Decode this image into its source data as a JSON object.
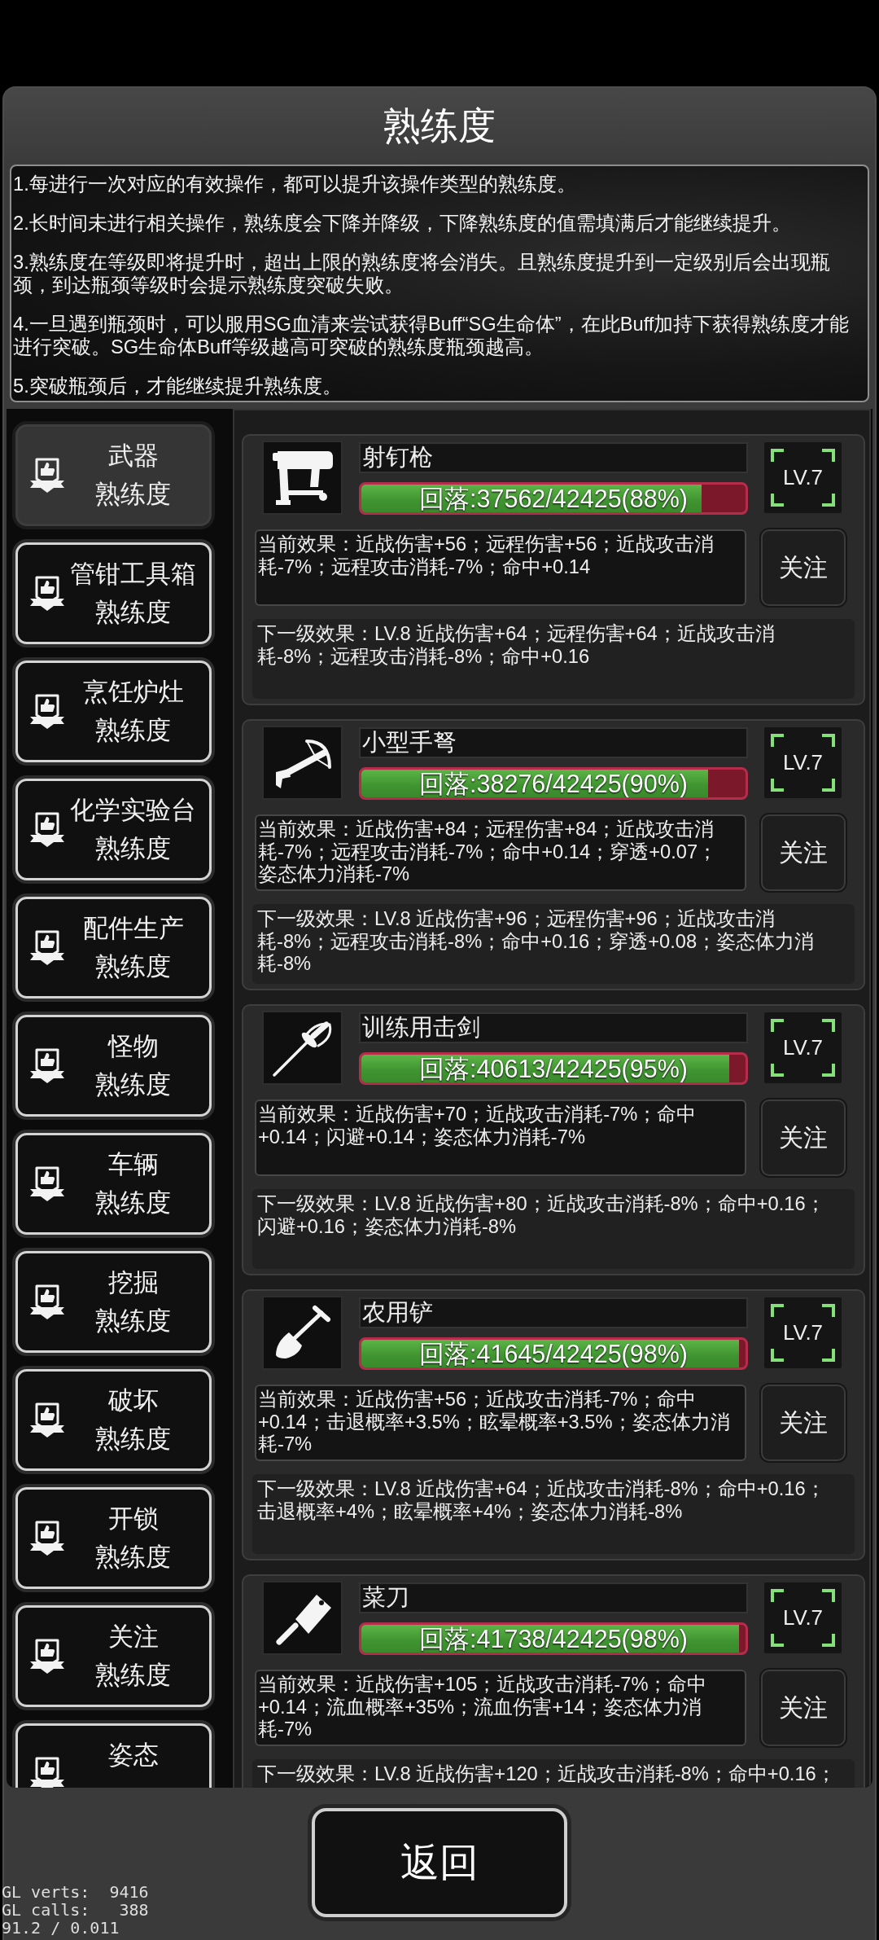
{
  "screen": {
    "title": "熟练度"
  },
  "rules": [
    "1.每进行一次对应的有效操作，都可以提升该操作类型的熟练度。",
    "2.长时间未进行相关操作，熟练度会下降并降级，下降熟练度的值需填满后才能继续提升。",
    "3.熟练度在等级即将提升时，超出上限的熟练度将会消失。且熟练度提升到一定级别后会出现瓶颈，到达瓶颈等级时会提示熟练度突破失败。",
    "4.一旦遇到瓶颈时，可以服用SG血清来尝试获得Buff“SG生命体”，在此Buff加持下获得熟练度才能进行突破。SG生命体Buff等级越高可突破的熟练度瓶颈越高。",
    "5.突破瓶颈后，才能继续提升熟练度。"
  ],
  "sidebar": {
    "items": [
      {
        "title": "武器",
        "subtitle": "熟练度",
        "selected": true
      },
      {
        "title": "管钳工具箱",
        "subtitle": "熟练度",
        "selected": false
      },
      {
        "title": "烹饪炉灶",
        "subtitle": "熟练度",
        "selected": false
      },
      {
        "title": "化学实验台",
        "subtitle": "熟练度",
        "selected": false
      },
      {
        "title": "配件生产",
        "subtitle": "熟练度",
        "selected": false
      },
      {
        "title": "怪物",
        "subtitle": "熟练度",
        "selected": false
      },
      {
        "title": "车辆",
        "subtitle": "熟练度",
        "selected": false
      },
      {
        "title": "挖掘",
        "subtitle": "熟练度",
        "selected": false
      },
      {
        "title": "破坏",
        "subtitle": "熟练度",
        "selected": false
      },
      {
        "title": "开锁",
        "subtitle": "熟练度",
        "selected": false
      },
      {
        "title": "关注",
        "subtitle": "熟练度",
        "selected": false
      },
      {
        "title": "姿态",
        "selected": false
      }
    ]
  },
  "cards": [
    {
      "name": "射钉枪",
      "progress": {
        "label": "回落:37562/42425(88%)",
        "level": 0.885
      },
      "level_badge": "LV.7",
      "current_effect": "当前效果：近战伤害+56；远程伤害+56；近战攻击消耗-7%；远程攻击消耗-7%；命中+0.14",
      "follow_button": "关注",
      "next_effect": "下一级效果：LV.8 近战伤害+64；远程伤害+64；近战攻击消耗-8%；远程攻击消耗-8%；命中+0.16"
    },
    {
      "name": "小型手弩",
      "progress": {
        "label": "回落:38276/42425(90%)",
        "level": 0.902
      },
      "level_badge": "LV.7",
      "current_effect": "当前效果：近战伤害+84；远程伤害+84；近战攻击消耗-7%；远程攻击消耗-7%；命中+0.14；穿透+0.07；姿态体力消耗-7%",
      "follow_button": "关注",
      "next_effect": "下一级效果：LV.8 近战伤害+96；远程伤害+96；近战攻击消耗-8%；远程攻击消耗-8%；命中+0.16；穿透+0.08；姿态体力消耗-8%"
    },
    {
      "name": "训练用击剑",
      "progress": {
        "label": "回落:40613/42425(95%)",
        "level": 0.957
      },
      "level_badge": "LV.7",
      "current_effect": "当前效果：近战伤害+70；近战攻击消耗-7%；命中+0.14；闪避+0.14；姿态体力消耗-7%",
      "follow_button": "关注",
      "next_effect": "下一级效果：LV.8 近战伤害+80；近战攻击消耗-8%；命中+0.16；闪避+0.16；姿态体力消耗-8%"
    },
    {
      "name": "农用铲",
      "progress": {
        "label": "回落:41645/42425(98%)",
        "level": 0.982
      },
      "level_badge": "LV.7",
      "current_effect": "当前效果：近战伤害+56；近战攻击消耗-7%；命中+0.14；击退概率+3.5%；眩晕概率+3.5%；姿态体力消耗-7%",
      "follow_button": "关注",
      "next_effect": "下一级效果：LV.8 近战伤害+64；近战攻击消耗-8%；命中+0.16；击退概率+4%；眩晕概率+4%；姿态体力消耗-8%"
    },
    {
      "name": "菜刀",
      "progress": {
        "label": "回落:41738/42425(98%)",
        "level": 0.984
      },
      "level_badge": "LV.7",
      "current_effect": "当前效果：近战伤害+105；近战攻击消耗-7%；命中+0.14；流血概率+35%；流血伤害+14；姿态体力消耗-7%",
      "follow_button": "关注",
      "next_effect": "下一级效果：LV.8 近战伤害+120；近战攻击消耗-8%；命中+0.16；"
    }
  ],
  "back_button": "返回",
  "debug_overlay": [
    "GL verts:  9416",
    "GL calls:   388",
    "91.2 / 0.011"
  ]
}
